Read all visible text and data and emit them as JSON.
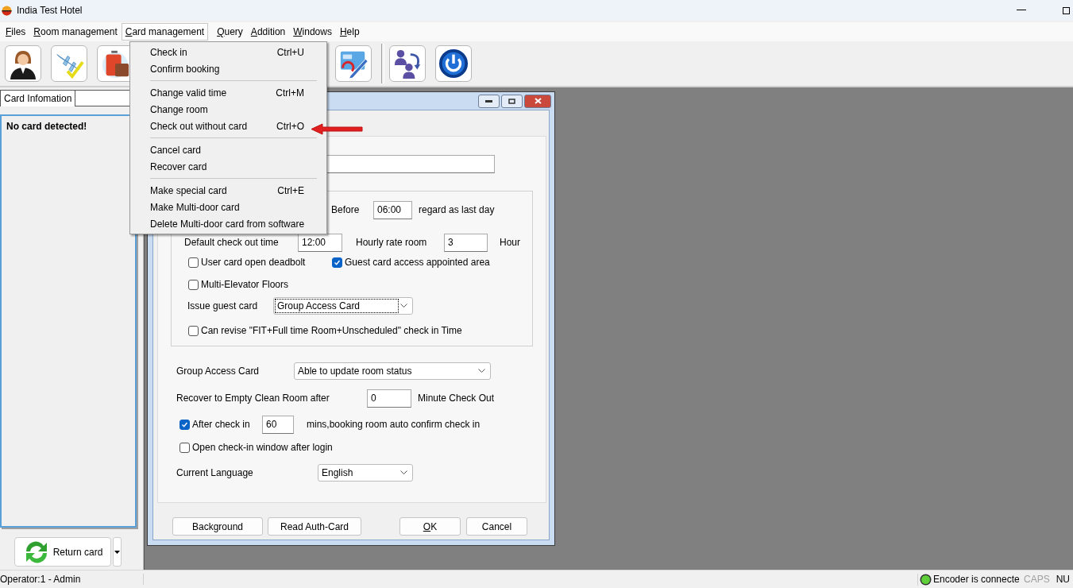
{
  "window": {
    "title": "India Test Hotel"
  },
  "menu_bar": [
    {
      "label": "Files",
      "selected": false
    },
    {
      "label": "Room management",
      "selected": false
    },
    {
      "label": "Card management",
      "selected": true
    },
    {
      "label": "Query",
      "selected": false
    },
    {
      "label": "Addition",
      "selected": false
    },
    {
      "label": "Windows",
      "selected": false
    },
    {
      "label": "Help",
      "selected": false
    }
  ],
  "open_menu": {
    "groups": [
      {
        "items": [
          {
            "label": "Check in",
            "shortcut": "Ctrl+U"
          },
          {
            "label": "Confirm booking"
          }
        ]
      },
      {
        "items": [
          {
            "label": "Change valid time",
            "shortcut": "Ctrl+M"
          },
          {
            "label": "Change room"
          },
          {
            "label": "Check out without card",
            "shortcut": "Ctrl+O"
          }
        ]
      },
      {
        "items": [
          {
            "label": "Cancel card"
          },
          {
            "label": "Recover card"
          }
        ]
      },
      {
        "items": [
          {
            "label": "Make special card",
            "shortcut": "Ctrl+E"
          },
          {
            "label": "Make Multi-door card"
          },
          {
            "label": "Delete Multi-door card from software"
          }
        ]
      }
    ]
  },
  "left_panel": {
    "tab": {
      "label": "Card Infomation",
      "selected": true
    },
    "message": "No card detected!",
    "return_button": "Return card"
  },
  "dialog": {
    "last_day": {
      "label": "Before",
      "value": "06:00",
      "suffix": "regard as last day"
    },
    "checkout": {
      "label": "Default check out time",
      "value": "12:00"
    },
    "hourly": {
      "label": "Hourly rate room",
      "value": "3",
      "unit": "Hour"
    },
    "options": [
      {
        "label": "User card open deadbolt",
        "checked": false
      },
      {
        "label": "Guest card access appointed area",
        "checked": true
      }
    ],
    "multi_elevator": {
      "label": "Multi-Elevator Floors",
      "checked": false
    },
    "issue_guest_card": {
      "label": "Issue guest card",
      "value": "Group Access Card"
    },
    "can_revise": {
      "label": "Can revise \"FIT+Full time Room+Unscheduled\" check in Time",
      "checked": false
    },
    "group_access": {
      "label": "Group Access Card",
      "value": "Able to update room status"
    },
    "recover": {
      "label": "Recover to Empty Clean Room after",
      "value": "0",
      "unit": "Minute Check Out"
    },
    "auto_confirm": {
      "label": "After check in",
      "checked": true,
      "value": "60",
      "suffix": "mins,booking room auto confirm check in"
    },
    "open_checkin": {
      "label": "Open check-in window after login",
      "checked": false
    },
    "language": {
      "label": "Current Language",
      "value": "English"
    },
    "buttons": [
      {
        "label": "Background",
        "mnemonic": false
      },
      {
        "label": "Read Auth-Card",
        "mnemonic": false
      },
      {
        "label": "OK",
        "mnemonic": true
      },
      {
        "label": "Cancel",
        "mnemonic": false
      }
    ]
  },
  "status_bar": {
    "operator": "Operator:1 - Admin",
    "encoder": {
      "text": "Encoder is connecte",
      "connected": true
    },
    "caps": {
      "label": "CAPS",
      "on": false
    },
    "num": {
      "label": "NU",
      "on": true
    }
  }
}
